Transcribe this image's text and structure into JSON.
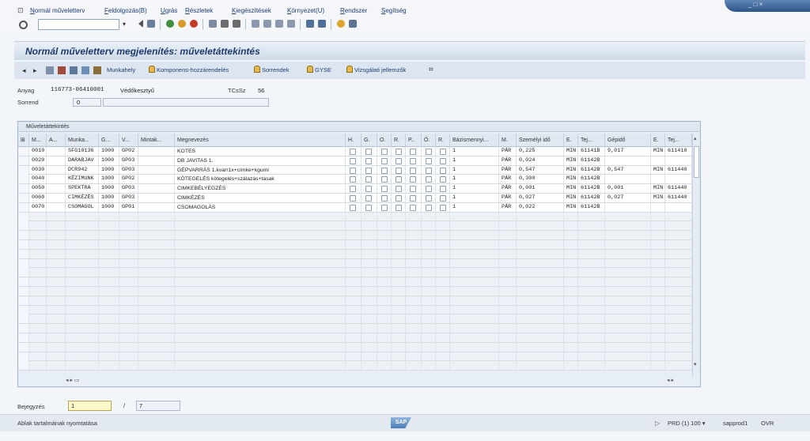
{
  "menu": {
    "items": [
      "Normál műveletterv",
      "Feldolgozás(B)",
      "Ugrás",
      "Részletek",
      "Kiegészítések",
      "Környezet(U)",
      "Rendszer",
      "Segítség"
    ]
  },
  "window": {
    "controls": "_ □ ×"
  },
  "title": "Normál műveletterv megjelenítés: műveletáttekintés",
  "app_toolbar": {
    "buttons": [
      "Munkahely",
      "Komponens-hozzárendelés",
      "Sorrendek",
      "GYSE",
      "Vizsgálati jellemzők"
    ]
  },
  "header": {
    "anyag_label": "Anyag",
    "anyag_value": "116773-06410001",
    "anyag_desc": "Védőkesztyű",
    "tcsz_label": "TCsSz",
    "tcsz_value": "56",
    "sorrend_label": "Sorrend",
    "sorrend_value": "0"
  },
  "table": {
    "caption": "Műveletáttekintés",
    "columns": [
      "M...",
      "A...",
      "Munka...",
      "G...",
      "V...",
      "Mintak...",
      "Megnevezés",
      "H.",
      "G.",
      "O.",
      "R.",
      "P..",
      "Ö.",
      "R.",
      "Bázismennyi...",
      "M.",
      "Személyi idő",
      "E.",
      "Tej...",
      "Gépidő",
      "E.",
      "Tej..."
    ],
    "rows": [
      {
        "muv": "0010",
        "munka": "SFG10136",
        "g": "1000",
        "v": "GP02",
        "megn": "KOTES",
        "bazis": "1",
        "m": "PÁR",
        "szem": "0,225",
        "e1": "MIN",
        "tej1": "61141B",
        "gep": "9,017",
        "e2": "MIN",
        "tej2": "611410"
      },
      {
        "muv": "0020",
        "munka": "DARABJAV",
        "g": "1000",
        "v": "GP03",
        "megn": "DB JAVITAS 1.",
        "bazis": "1",
        "m": "PÁR",
        "szem": "0,024",
        "e1": "MIN",
        "tej1": "61142B",
        "gep": "",
        "e2": "",
        "tej2": ""
      },
      {
        "muv": "0030",
        "munka": "DCR942",
        "g": "1000",
        "v": "GP03",
        "megn": "GÉPVARRÁS 1.kvarr1x+címke+kgumi",
        "bazis": "1",
        "m": "PÁR",
        "szem": "0,547",
        "e1": "MIN",
        "tej1": "61142B",
        "gep": "0,547",
        "e2": "MIN",
        "tej2": "611440"
      },
      {
        "muv": "0040",
        "munka": "KÉZIMUNK",
        "g": "1000",
        "v": "GP02",
        "megn": "KÖTEGELÉS kötegelés+szálazás+tasak",
        "bazis": "1",
        "m": "PÁR",
        "szem": "0,300",
        "e1": "MIN",
        "tej1": "61142B",
        "gep": "",
        "e2": "",
        "tej2": ""
      },
      {
        "muv": "0050",
        "munka": "SPEKTRA",
        "g": "1000",
        "v": "GP03",
        "megn": "CIMKEBÉLYEGZÉS",
        "bazis": "1",
        "m": "PÁR",
        "szem": "0,001",
        "e1": "MIN",
        "tej1": "61142B",
        "gep": "0,001",
        "e2": "MIN",
        "tej2": "611440"
      },
      {
        "muv": "0060",
        "munka": "CIMKÉZÉS",
        "g": "1000",
        "v": "GP03",
        "megn": "CIMKÉZÉS",
        "bazis": "1",
        "m": "PÁR",
        "szem": "0,027",
        "e1": "MIN",
        "tej1": "61142B",
        "gep": "0,027",
        "e2": "MIN",
        "tej2": "611440"
      },
      {
        "muv": "0070",
        "munka": "CSOMAGOL",
        "g": "1000",
        "v": "GP01",
        "megn": "CSOMAGOLÁS",
        "bazis": "1",
        "m": "PÁR",
        "szem": "0,022",
        "e1": "MIN",
        "tej1": "61142B",
        "gep": "",
        "e2": "",
        "tej2": ""
      }
    ]
  },
  "footer": {
    "bejegyzes_label": "Bejegyzés",
    "bejegyzes_value": "1",
    "slash": "/",
    "total_value": "7"
  },
  "status": {
    "message": "Ablak tartalmának nyomtatása",
    "logo": "SAP",
    "play": "▷",
    "system": "PRD (1) 100 ▾",
    "server": "sapprod1",
    "mode": "OVR"
  }
}
